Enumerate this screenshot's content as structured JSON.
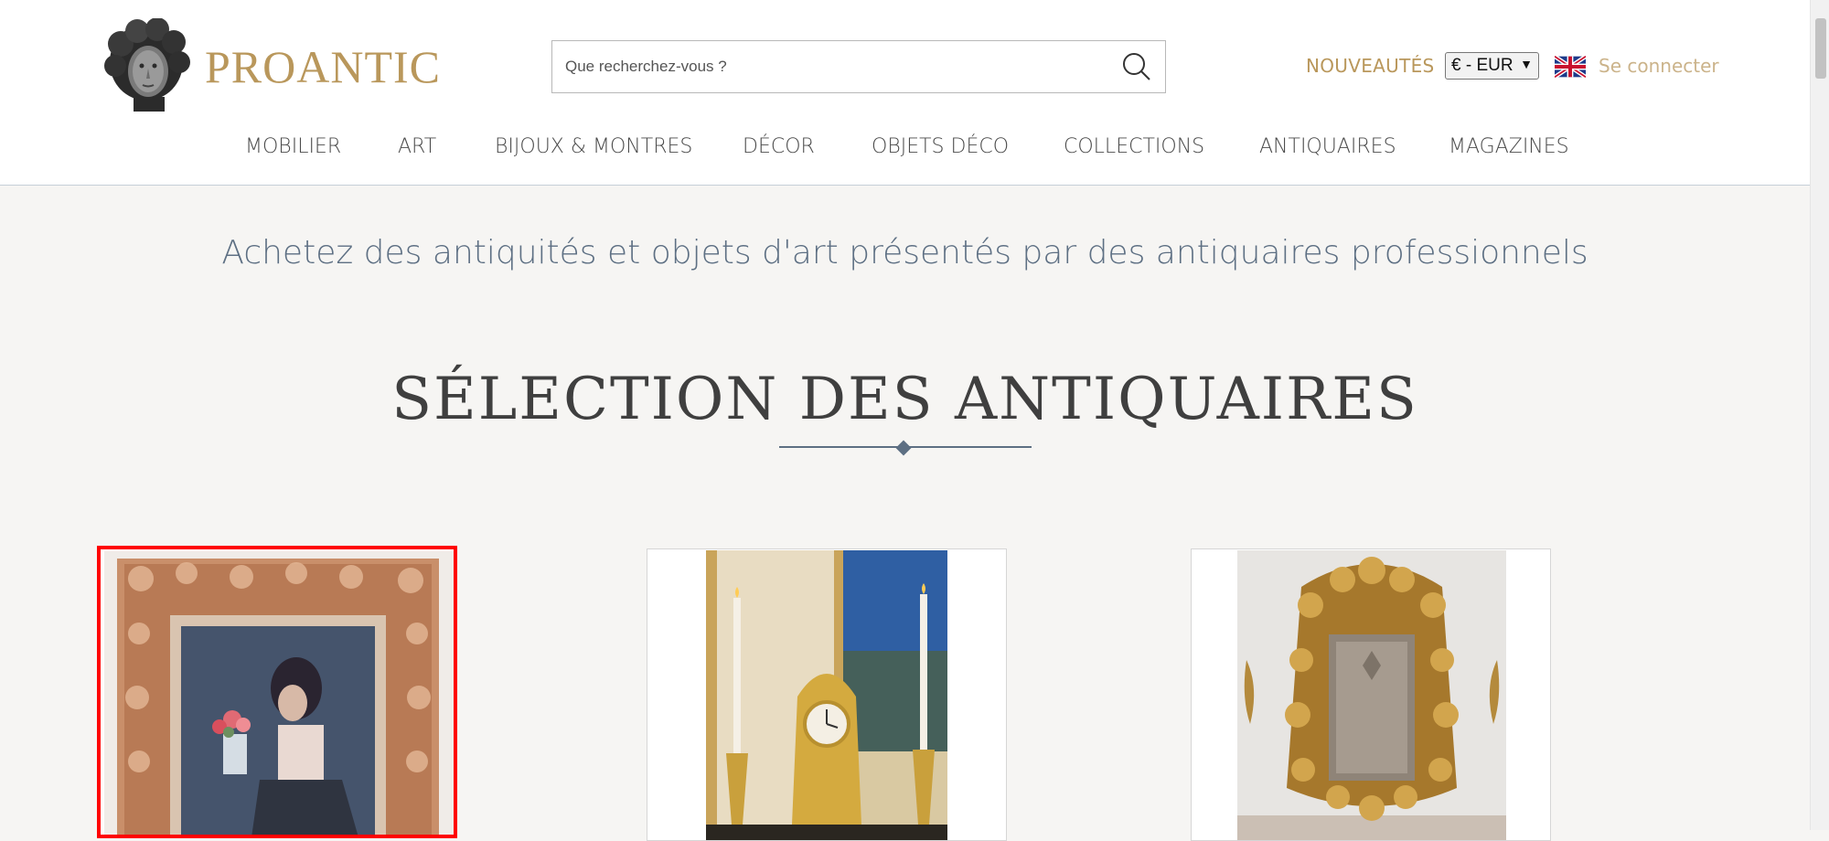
{
  "header": {
    "logo_text": "PROANTIC",
    "search": {
      "placeholder": "Que recherchez-vous ?",
      "value": ""
    },
    "new_label": "NOUVEAUTÉS",
    "currency": "€ - EUR",
    "login_label": "Se connecter"
  },
  "nav": {
    "items": [
      {
        "label": "MOBILIER"
      },
      {
        "label": "ART"
      },
      {
        "label": "BIJOUX & MONTRES"
      },
      {
        "label": "DÉCOR"
      },
      {
        "label": "OBJETS DÉCO"
      },
      {
        "label": "COLLECTIONS"
      },
      {
        "label": "ANTIQUAIRES"
      },
      {
        "label": "MAGAZINES"
      }
    ]
  },
  "main": {
    "tagline": "Achetez des antiquités et objets d'art présentés par des antiquaires professionnels",
    "section_title": "SÉLECTION DES ANTIQUAIRES"
  },
  "colors": {
    "gold": "#b9975b",
    "slate": "#5d6f83",
    "selection": "#ff0000"
  }
}
